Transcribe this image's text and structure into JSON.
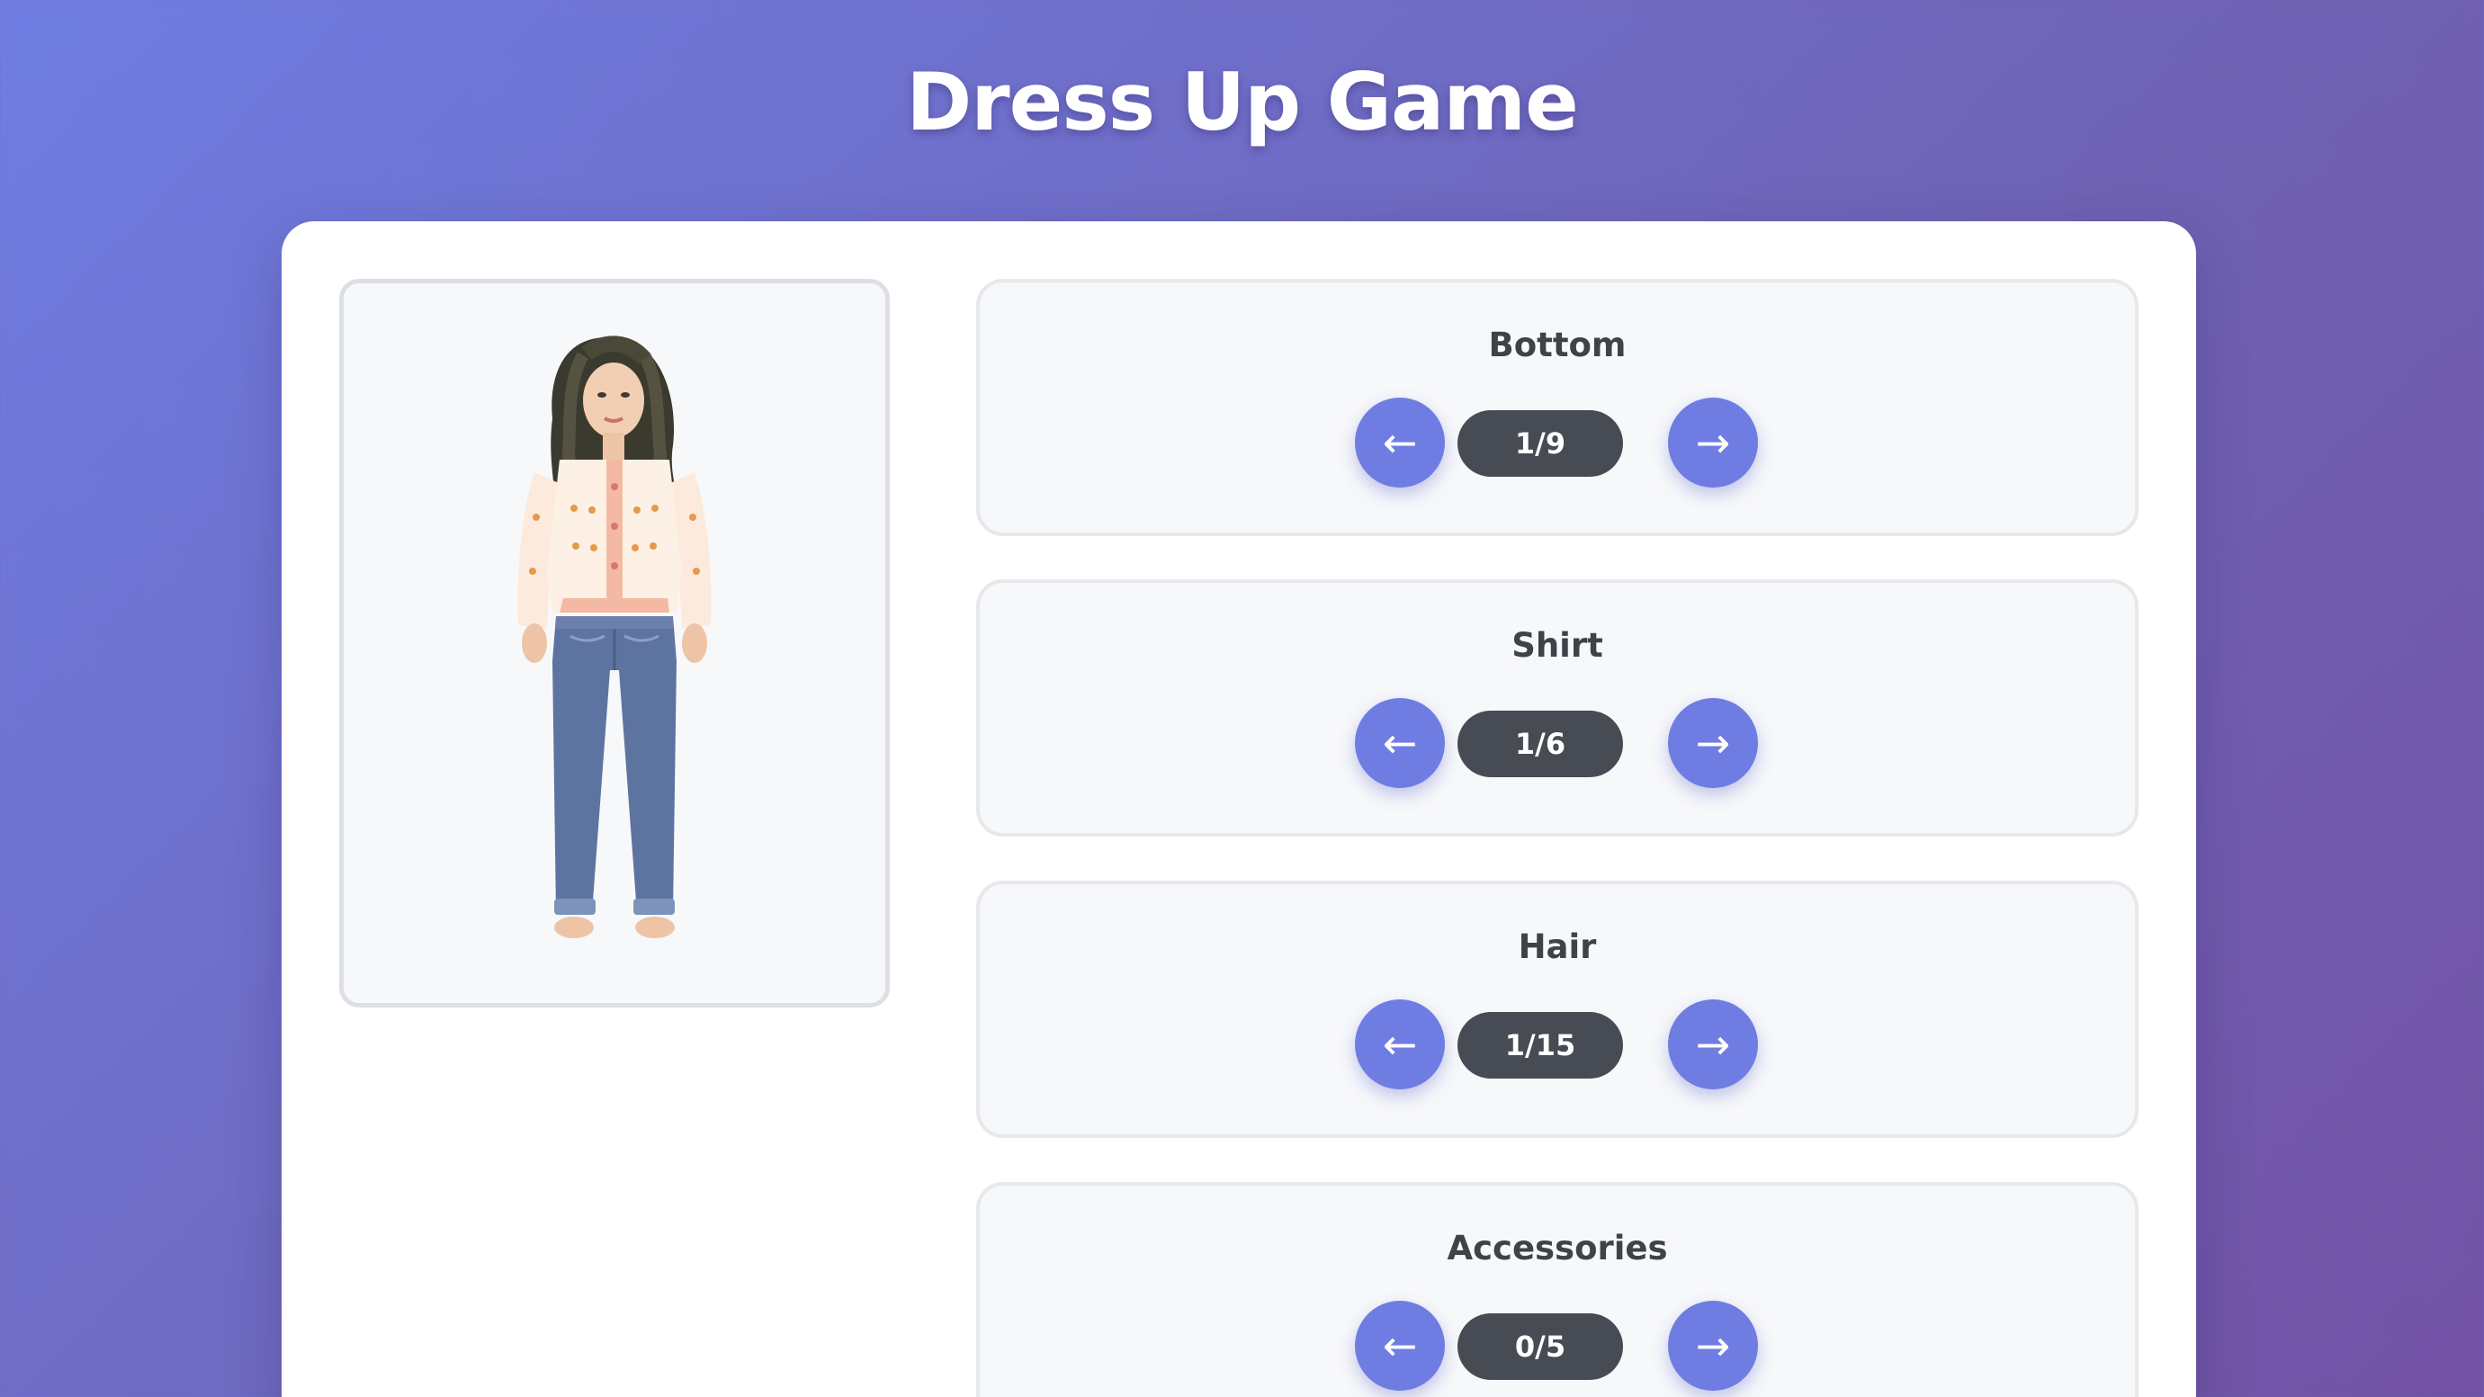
{
  "page": {
    "title": "Dress Up Game"
  },
  "colors": {
    "accent": "#6f7de2",
    "counter_bg": "#474b53",
    "card_bg": "#f7f8fa"
  },
  "icons": {
    "prev": "arrow-left-icon",
    "next": "arrow-right-icon"
  },
  "categories": [
    {
      "label": "Bottom",
      "counter": "1/9",
      "prev_symbol": "←",
      "next_symbol": "→"
    },
    {
      "label": "Shirt",
      "counter": "1/6",
      "prev_symbol": "←",
      "next_symbol": "→"
    },
    {
      "label": "Hair",
      "counter": "1/15",
      "prev_symbol": "←",
      "next_symbol": "→"
    },
    {
      "label": "Accessories",
      "counter": "0/5",
      "prev_symbol": "←",
      "next_symbol": "→"
    }
  ]
}
